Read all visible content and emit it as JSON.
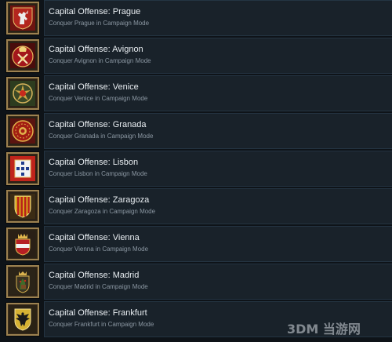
{
  "achievements": [
    {
      "title": "Capital Offense: Prague",
      "description": "Conquer Prague in Campaign Mode",
      "icon": "prague-lion-crest-icon",
      "color": "#b3261e"
    },
    {
      "title": "Capital Offense: Avignon",
      "description": "Conquer Avignon in Campaign Mode",
      "icon": "avignon-papal-crest-icon",
      "color": "#a3161b"
    },
    {
      "title": "Capital Offense: Venice",
      "description": "Conquer Venice in Campaign Mode",
      "icon": "venice-crest-icon",
      "color": "#2d3c1f"
    },
    {
      "title": "Capital Offense: Granada",
      "description": "Conquer Granada in Campaign Mode",
      "icon": "granada-crest-icon",
      "color": "#a31d12"
    },
    {
      "title": "Capital Offense: Lisbon",
      "description": "Conquer Lisbon in Campaign Mode",
      "icon": "lisbon-crest-icon",
      "color": "#c0241b"
    },
    {
      "title": "Capital Offense: Zaragoza",
      "description": "Conquer Zaragoza in Campaign Mode",
      "icon": "zaragoza-striped-shield-icon",
      "color": "#d4a11a"
    },
    {
      "title": "Capital Offense: Vienna",
      "description": "Conquer Vienna in Campaign Mode",
      "icon": "vienna-crowned-shield-icon",
      "color": "#b51f24"
    },
    {
      "title": "Capital Offense: Madrid",
      "description": "Conquer Madrid in Campaign Mode",
      "icon": "madrid-crest-icon",
      "color": "#3a3322"
    },
    {
      "title": "Capital Offense: Frankfurt",
      "description": "Conquer Frankfurt in Campaign Mode",
      "icon": "frankfurt-eagle-shield-icon",
      "color": "#d6b233"
    }
  ],
  "watermark": {
    "text": "3DM 当游网",
    "logo": "watermark-logo-icon"
  }
}
